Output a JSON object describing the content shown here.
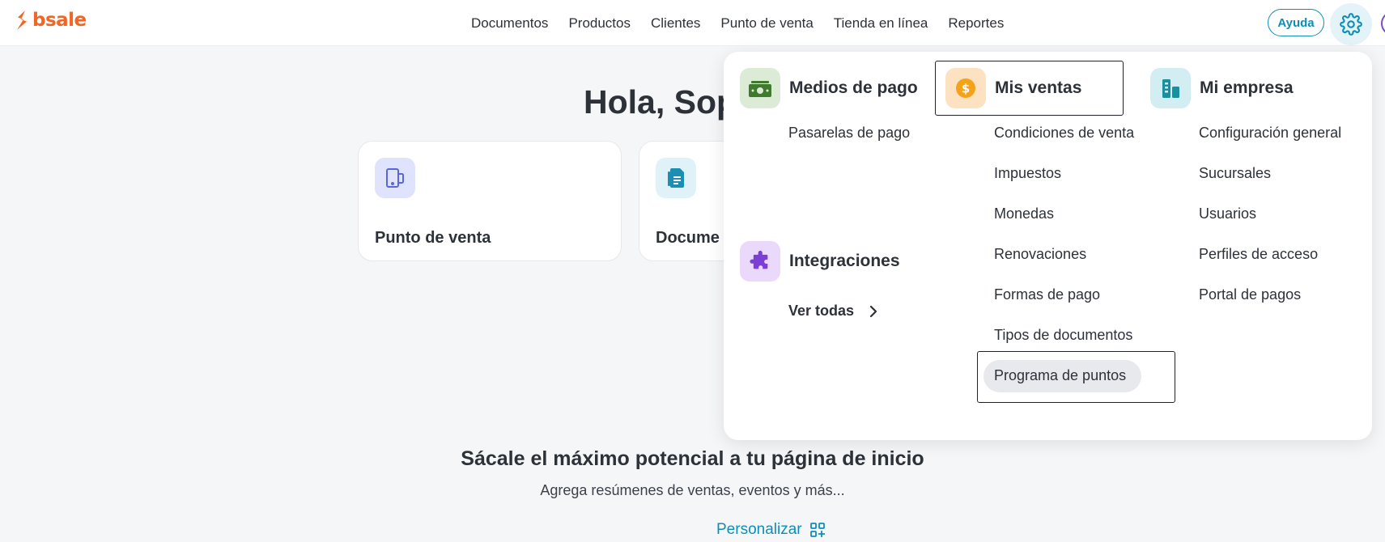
{
  "brand": {
    "name": "bsale",
    "color": "#f26522"
  },
  "nav": {
    "items": [
      "Documentos",
      "Productos",
      "Clientes",
      "Punto de venta",
      "Tienda en línea",
      "Reportes"
    ]
  },
  "header": {
    "help_label": "Ayuda",
    "settings_icon": "gear-icon"
  },
  "main": {
    "greeting": "Hola, Sop",
    "cards": [
      {
        "title": "Punto de venta",
        "icon": "tablet-icon"
      },
      {
        "title": "Docume",
        "icon": "document-icon"
      }
    ],
    "promo_title": "Sácale el máximo potencial a tu página de inicio",
    "promo_subtitle": "Agrega resúmenes de ventas, eventos y más...",
    "customize_label": "Personalizar"
  },
  "settings_menu": {
    "payment_methods": {
      "title": "Medios de pago",
      "icon": "money-icon",
      "items": [
        "Pasarelas de pago"
      ]
    },
    "integrations": {
      "title": "Integraciones",
      "icon": "puzzle-icon",
      "view_all": "Ver todas"
    },
    "my_sales": {
      "title": "Mis ventas",
      "icon": "coin-icon",
      "items": [
        "Condiciones de venta",
        "Impuestos",
        "Monedas",
        "Renovaciones",
        "Formas de pago",
        "Tipos de documentos",
        "Programa de puntos"
      ]
    },
    "my_company": {
      "title": "Mi empresa",
      "icon": "building-icon",
      "items": [
        "Configuración general",
        "Sucursales",
        "Usuarios",
        "Perfiles de acceso",
        "Portal de pagos"
      ]
    }
  },
  "colors": {
    "accent": "#0d8fb5",
    "payment_icon_bg": "#dcebd6",
    "sales_icon_bg": "#fde2c2",
    "company_icon_bg": "#d2eef2",
    "integrations_icon_bg": "#ead9fb"
  }
}
